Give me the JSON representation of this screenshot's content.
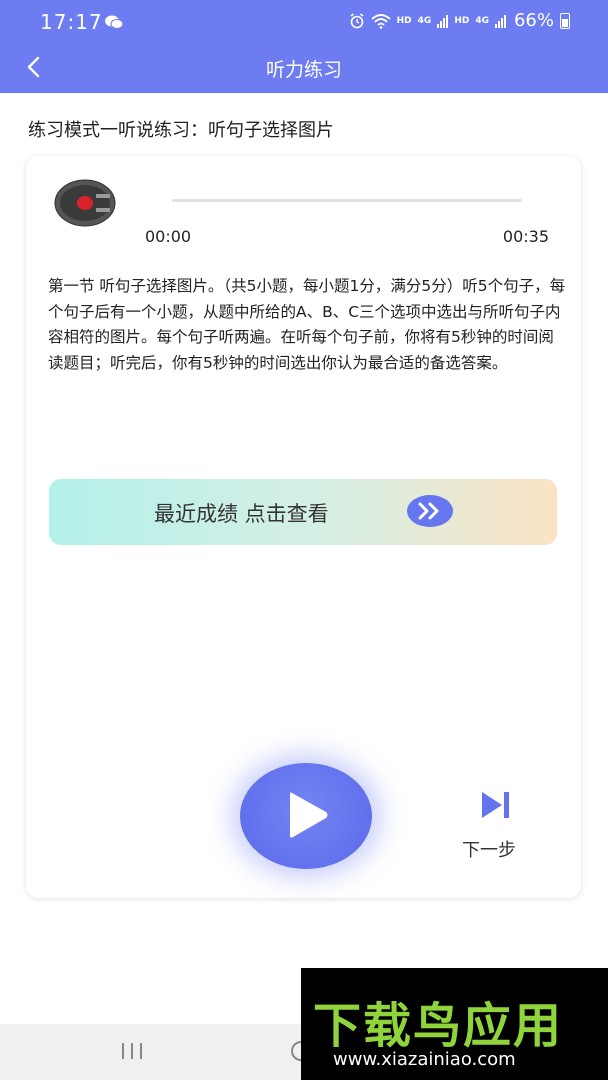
{
  "status_bar": {
    "time": "17:17",
    "hd1": "HD",
    "net1": "4G",
    "hd2": "HD",
    "net2": "4G",
    "battery": "66%"
  },
  "header": {
    "title": "听力练习",
    "back_icon": "chevron-left-icon"
  },
  "mode_line": "练习模式一听说练习：听句子选择图片",
  "player": {
    "current_time": "00:00",
    "total_time": "00:35",
    "progress": 0
  },
  "description": "第一节 听句子选择图片。（共5小题，每小题1分，满分5分）听5个句子，每个句子后有一个小题，从题中所给的A、B、C三个选项中选出与所听句子内容相符的图片。每个句子听两遍。在听每个句子前，你将有5秒钟的时间阅读题目；听完后，你有5秒钟的时间选出你认为最合适的备选答案。",
  "scores_button": {
    "label": "最近成绩 点击查看",
    "icon": "double-chevron-right-icon"
  },
  "controls": {
    "play_icon": "play-icon",
    "next_label": "下一步",
    "next_icon": "skip-next-icon"
  },
  "watermark": {
    "logo": "下载鸟应用",
    "url": "www.xiazainiao.com"
  },
  "colors": {
    "accent": "#6d7df1",
    "play": "#6474ee",
    "watermark_green": "#8fd43a"
  }
}
